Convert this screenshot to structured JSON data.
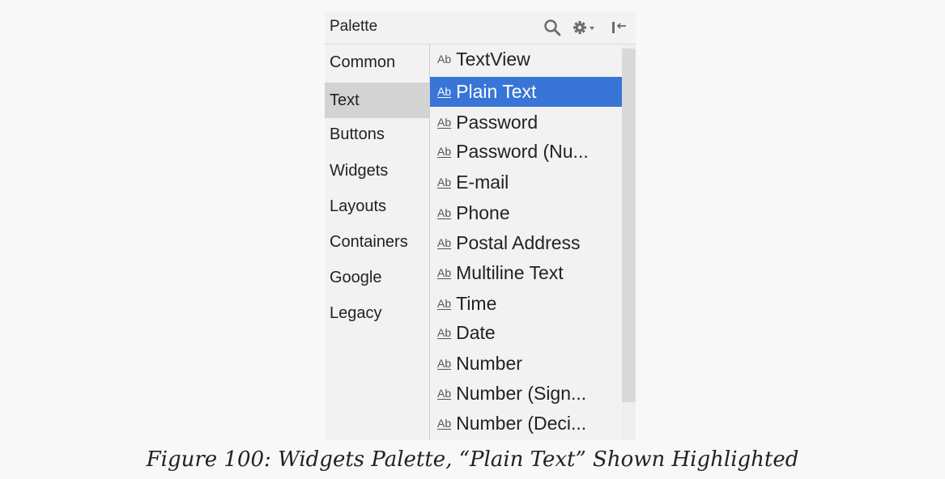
{
  "palette": {
    "title": "Palette",
    "icons": [
      "search-icon",
      "gear-dropdown-icon",
      "collapse-panel-icon"
    ]
  },
  "categories": [
    {
      "label": "Common",
      "selected": false
    },
    {
      "label": "Text",
      "selected": true
    },
    {
      "label": "Buttons",
      "selected": false
    },
    {
      "label": "Widgets",
      "selected": false
    },
    {
      "label": "Layouts",
      "selected": false
    },
    {
      "label": "Containers",
      "selected": false
    },
    {
      "label": "Google",
      "selected": false
    },
    {
      "label": "Legacy",
      "selected": false
    }
  ],
  "widgets": [
    {
      "icon": "Ab",
      "label": "TextView",
      "selected": false
    },
    {
      "icon": "Ab",
      "label": "Plain Text",
      "selected": true
    },
    {
      "icon": "Ab",
      "label": "Password",
      "selected": false
    },
    {
      "icon": "Ab",
      "label": "Password (Nu...",
      "selected": false
    },
    {
      "icon": "Ab",
      "label": "E-mail",
      "selected": false
    },
    {
      "icon": "Ab",
      "label": "Phone",
      "selected": false
    },
    {
      "icon": "Ab",
      "label": "Postal Address",
      "selected": false
    },
    {
      "icon": "Ab",
      "label": "Multiline Text",
      "selected": false
    },
    {
      "icon": "Ab",
      "label": "Time",
      "selected": false
    },
    {
      "icon": "Ab",
      "label": "Date",
      "selected": false
    },
    {
      "icon": "Ab",
      "label": "Number",
      "selected": false
    },
    {
      "icon": "Ab",
      "label": "Number (Sign...",
      "selected": false
    },
    {
      "icon": "Ab",
      "label": "Number (Deci...",
      "selected": false
    }
  ],
  "colors": {
    "selection": "#3875d7",
    "category_selected": "#d3d3d3",
    "panel_background": "#f2f2f2"
  },
  "caption": "Figure 100: Widgets Palette, “Plain Text” Shown Highlighted"
}
